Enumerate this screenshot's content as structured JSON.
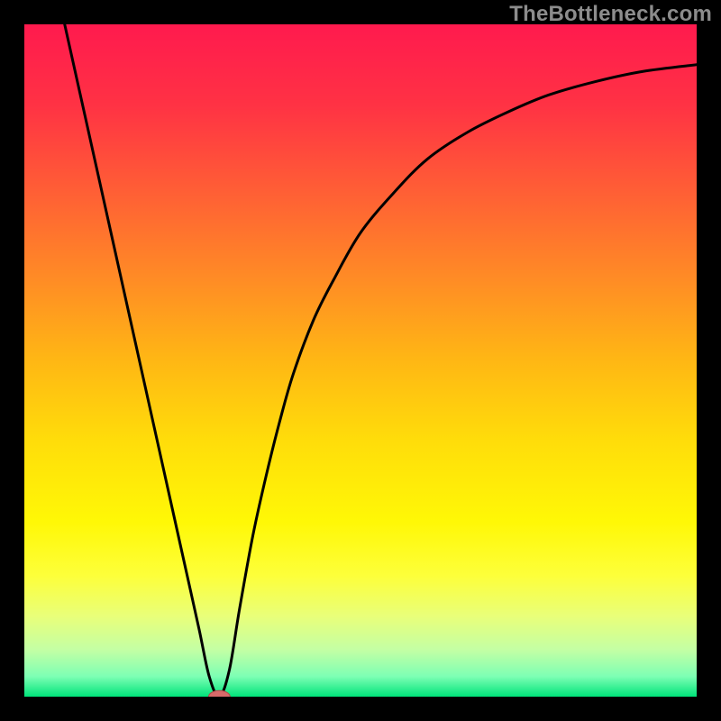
{
  "watermark": "TheBottleneck.com",
  "chart_data": {
    "type": "line",
    "title": "",
    "xlabel": "",
    "ylabel": "",
    "xlim": [
      0,
      100
    ],
    "ylim": [
      0,
      100
    ],
    "background": {
      "type": "vertical-gradient",
      "stops": [
        {
          "pos": 0.0,
          "color": "#ff1a4e"
        },
        {
          "pos": 0.12,
          "color": "#ff3244"
        },
        {
          "pos": 0.25,
          "color": "#ff5f35"
        },
        {
          "pos": 0.38,
          "color": "#ff8c25"
        },
        {
          "pos": 0.5,
          "color": "#ffb714"
        },
        {
          "pos": 0.62,
          "color": "#ffdd0a"
        },
        {
          "pos": 0.74,
          "color": "#fff806"
        },
        {
          "pos": 0.82,
          "color": "#fdff3a"
        },
        {
          "pos": 0.88,
          "color": "#e9ff79"
        },
        {
          "pos": 0.93,
          "color": "#c4ffa4"
        },
        {
          "pos": 0.97,
          "color": "#7dffb4"
        },
        {
          "pos": 1.0,
          "color": "#00e47a"
        }
      ]
    },
    "series": [
      {
        "name": "bottleneck-curve",
        "type": "line",
        "color": "#000000",
        "x": [
          6.0,
          8.0,
          10.0,
          12.0,
          14.0,
          16.0,
          18.0,
          20.0,
          22.0,
          24.0,
          26.0,
          27.5,
          29.0,
          30.5,
          32.0,
          34.0,
          36.0,
          38.0,
          40.0,
          43.0,
          46.0,
          50.0,
          55.0,
          60.0,
          66.0,
          72.0,
          78.0,
          85.0,
          92.0,
          100.0
        ],
        "y": [
          100.0,
          91.0,
          82.0,
          73.0,
          64.0,
          55.0,
          46.0,
          37.0,
          28.0,
          19.0,
          10.0,
          3.0,
          0.0,
          4.0,
          13.0,
          24.0,
          33.0,
          41.0,
          48.0,
          56.0,
          62.0,
          69.0,
          75.0,
          80.0,
          84.0,
          87.0,
          89.5,
          91.5,
          93.0,
          94.0
        ]
      }
    ],
    "marker": {
      "name": "optimal-point",
      "x": 29.0,
      "y": 0.0,
      "shape": "ellipse",
      "rx": 1.6,
      "ry": 0.9,
      "fill": "#d86a6a",
      "stroke": "#b24a4a"
    }
  }
}
